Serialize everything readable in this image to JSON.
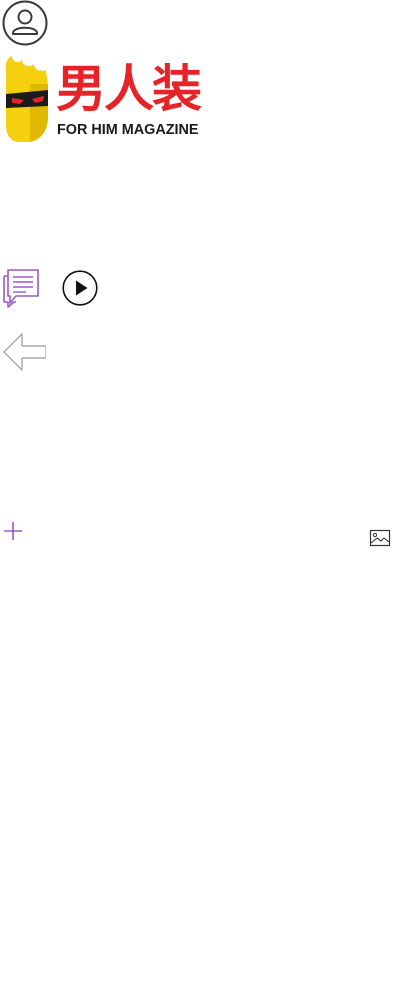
{
  "header": {
    "account_icon": "user-circle-icon"
  },
  "brand": {
    "name_cn": "男人装",
    "tagline": "FOR HIM MAGAZINE",
    "mascot_icon": "yellow-mask-mascot",
    "brand_red": "#e52428",
    "mascot_yellow": "#f5d00f"
  },
  "actions": {
    "comment_icon": "comment-icon",
    "play_icon": "play-circle-icon",
    "back_icon": "back-arrow-icon",
    "add_icon": "plus-icon",
    "image_icon": "image-icon",
    "accent_color": "#9b59c9"
  }
}
